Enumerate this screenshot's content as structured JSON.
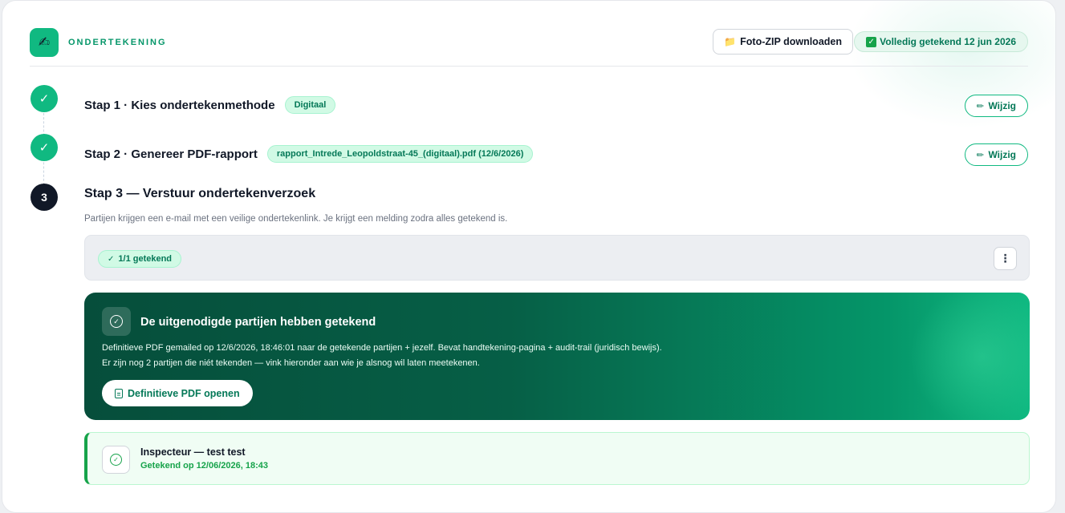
{
  "header": {
    "logo_icon": "✍",
    "title": "ONDERTEKENING",
    "zip_icon": "📁",
    "zip_label": "Foto-ZIP downloaden",
    "status_label": "Volledig getekend 12 jun 2026"
  },
  "steps": [
    {
      "marker": "✓",
      "title": "Stap 1 · Kies ondertekenmethode",
      "chip": "Digitaal",
      "edit_label": "Wijzig"
    },
    {
      "marker": "✓",
      "title": "Stap 2 · Genereer PDF-rapport",
      "chip": "rapport_Intrede_Leopoldstraat-45_(digitaal).pdf (12/6/2026)",
      "edit_label": "Wijzig"
    }
  ],
  "step3": {
    "number": "3",
    "title": "Stap 3 — Verstuur ondertekenverzoek",
    "description": "Partijen krijgen een e-mail met een veilige ondertekenlink. Je krijgt een melding zodra alles getekend is.",
    "signed_count": "1/1 getekend",
    "more_icon": "⋮"
  },
  "panel": {
    "title": "De uitgenodigde partijen hebben getekend",
    "line1": "Definitieve PDF gemailed op 12/6/2026, 18:46:01 naar de getekende partijen + jezelf. Bevat handtekening-pagina + audit-trail (juridisch bewijs).",
    "line2": "Er zijn nog 2 partijen die niét tekenden — vink hieronder aan wie je alsnog wil laten meetekenen.",
    "button_label": "Definitieve PDF openen"
  },
  "party": {
    "name": "Inspecteur — test test",
    "status": "Getekend op 12/06/2026, 18:43"
  },
  "colors": {
    "accent": "#10b981",
    "accent_dark": "#047857",
    "panel_dark": "#064e3b",
    "step_active": "#111827"
  }
}
